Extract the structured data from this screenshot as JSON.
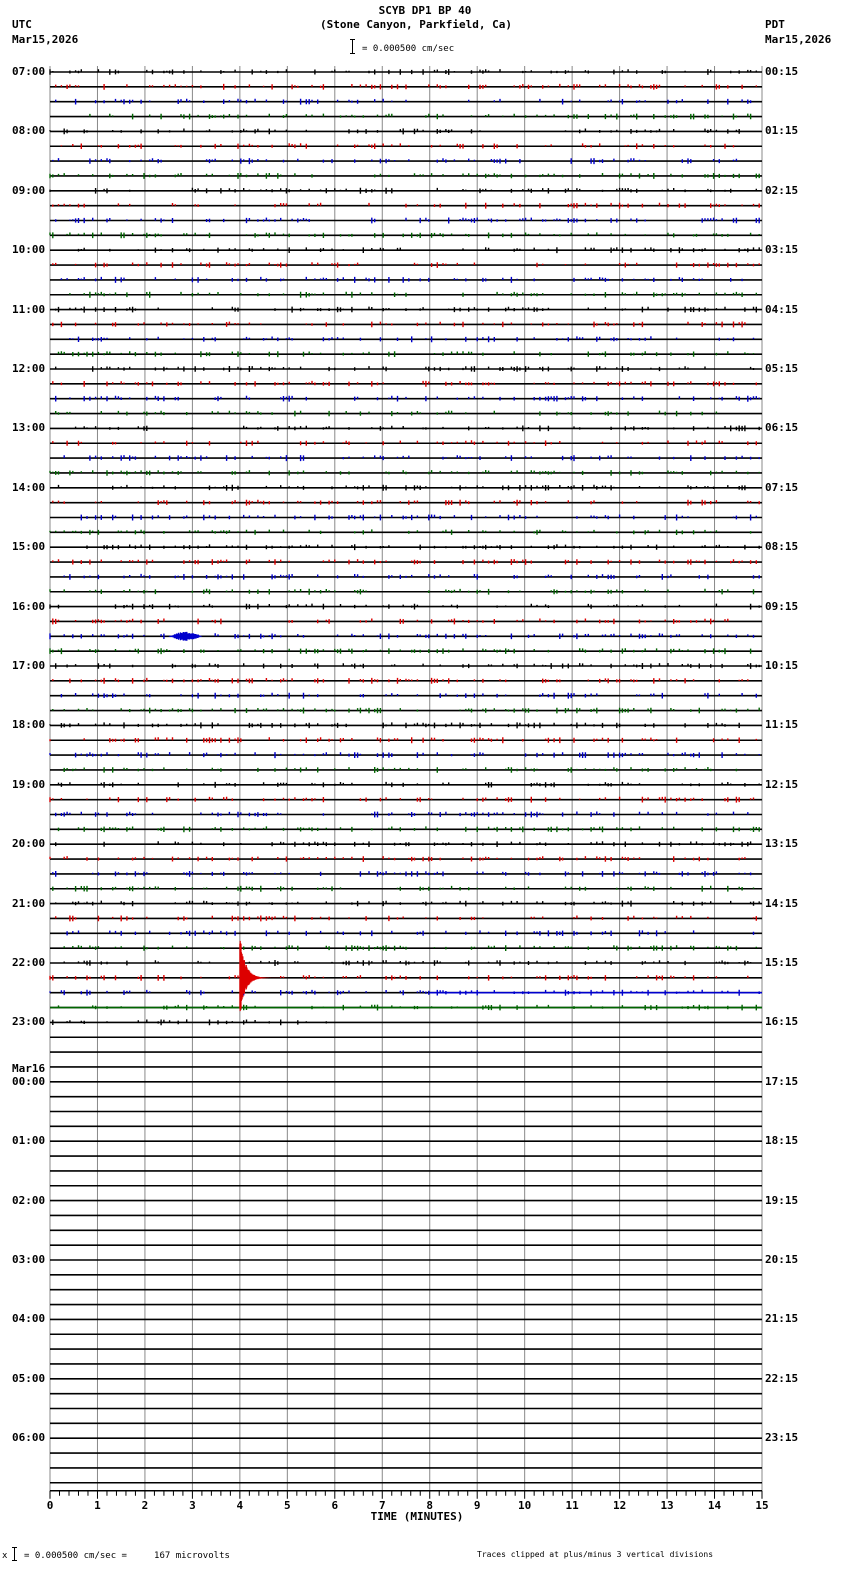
{
  "header": {
    "title": "SCYB DP1 BP 40",
    "subtitle": "(Stone Canyon, Parkfield, Ca)",
    "left_tz": "UTC",
    "left_date": "Mar15,2026",
    "right_tz": "PDT",
    "right_date": "Mar15,2026",
    "scale": "= 0.000500 cm/sec"
  },
  "footer": {
    "scale_prefix": "x",
    "scale_text": "= 0.000500 cm/sec =     167 microvolts",
    "clip_note": "Traces clipped at plus/minus 3 vertical divisions"
  },
  "chart_data": {
    "type": "line",
    "title": "SCYB DP1 BP 40",
    "xlabel": "TIME (MINUTES)",
    "xlim": [
      0,
      15
    ],
    "x_ticks": [
      "0",
      "1",
      "2",
      "3",
      "4",
      "5",
      "6",
      "7",
      "8",
      "9",
      "10",
      "11",
      "12",
      "13",
      "14",
      "15"
    ],
    "trace_minutes": 15,
    "traces_per_hour": 4,
    "trace_colors": [
      "#000000",
      "#dd0000",
      "#0000cc",
      "#006600"
    ],
    "left_labels": [
      "07:00",
      "08:00",
      "09:00",
      "10:00",
      "11:00",
      "12:00",
      "13:00",
      "14:00",
      "15:00",
      "16:00",
      "17:00",
      "18:00",
      "19:00",
      "20:00",
      "21:00",
      "22:00",
      "23:00",
      "00:00",
      "01:00",
      "02:00",
      "03:00",
      "04:00",
      "05:00",
      "06:00"
    ],
    "date_change_label": "Mar16",
    "right_labels": [
      "00:15",
      "01:15",
      "02:15",
      "03:15",
      "04:15",
      "05:15",
      "06:15",
      "07:15",
      "08:15",
      "09:15",
      "10:15",
      "11:15",
      "12:15",
      "13:15",
      "14:15",
      "15:15",
      "16:15",
      "17:15",
      "18:15",
      "19:15",
      "20:15",
      "21:15",
      "22:15",
      "23:15"
    ],
    "data_end": {
      "utc_trace": "23:00",
      "minute": 6
    },
    "events": [
      {
        "utc_trace": "16:30",
        "start_minute": 2.5,
        "end_minute": 3.2,
        "amplitude_divisions": 0.3
      },
      {
        "utc_trace": "22:15",
        "start_minute": 4.0,
        "end_minute": 5.0,
        "amplitude_divisions": 3,
        "clipped": true
      }
    ],
    "clip_divisions": 3
  }
}
